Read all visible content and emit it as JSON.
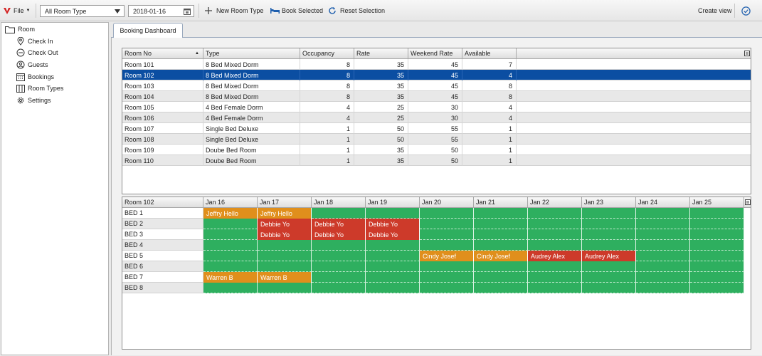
{
  "toolbar": {
    "file_label": "File",
    "room_type_value": "All Room Type",
    "date_value": "2018-01-16",
    "new_room_type": "New Room Type",
    "book_selected": "Book Selected",
    "reset_selection": "Reset Selection",
    "create_view": "Create view"
  },
  "sidebar": {
    "root": "Room",
    "items": [
      {
        "label": "Check In",
        "icon": "location-pin-icon"
      },
      {
        "label": "Check Out",
        "icon": "minus-circle-icon"
      },
      {
        "label": "Guests",
        "icon": "guests-icon"
      },
      {
        "label": "Bookings",
        "icon": "calendar-icon"
      },
      {
        "label": "Room Types",
        "icon": "room-types-icon"
      },
      {
        "label": "Settings",
        "icon": "gear-icon"
      }
    ]
  },
  "tab": {
    "label": "Booking Dashboard"
  },
  "rooms": {
    "columns": [
      "Room No",
      "Type",
      "Occupancy",
      "Rate",
      "Weekend Rate",
      "Available"
    ],
    "selected_index": 1,
    "rows": [
      [
        "Room 101",
        "8 Bed Mixed Dorm",
        "8",
        "35",
        "45",
        "7"
      ],
      [
        "Room 102",
        "8 Bed Mixed Dorm",
        "8",
        "35",
        "45",
        "4"
      ],
      [
        "Room 103",
        "8 Bed Mixed Dorm",
        "8",
        "35",
        "45",
        "8"
      ],
      [
        "Room 104",
        "8 Bed Mixed Dorm",
        "8",
        "35",
        "45",
        "8"
      ],
      [
        "Room 105",
        "4 Bed Female Dorm",
        "4",
        "25",
        "30",
        "4"
      ],
      [
        "Room 106",
        "4 Bed Female Dorm",
        "4",
        "25",
        "30",
        "4"
      ],
      [
        "Room 107",
        "Single Bed Deluxe",
        "1",
        "50",
        "55",
        "1"
      ],
      [
        "Room 108",
        "Single Bed Deluxe",
        "1",
        "50",
        "55",
        "1"
      ],
      [
        "Room 109",
        "Doube Bed Room",
        "1",
        "35",
        "50",
        "1"
      ],
      [
        "Room 110",
        "Doube Bed Room",
        "1",
        "35",
        "50",
        "1"
      ]
    ]
  },
  "schedule": {
    "room": "Room 102",
    "days": [
      "Jan 16",
      "Jan 17",
      "Jan 18",
      "Jan 19",
      "Jan 20",
      "Jan 21",
      "Jan 22",
      "Jan 23",
      "Jan 24",
      "Jan 25"
    ],
    "beds": [
      "BED 1",
      "BED 2",
      "BED 3",
      "BED 4",
      "BED 5",
      "BED 6",
      "BED 7",
      "BED 8"
    ],
    "bookings": [
      {
        "bed": 0,
        "day": 0,
        "guest": "Jeffry Hello",
        "status": "orange"
      },
      {
        "bed": 0,
        "day": 1,
        "guest": "Jeffry Hello",
        "status": "orange"
      },
      {
        "bed": 1,
        "day": 1,
        "guest": "Debbie Yo",
        "status": "red"
      },
      {
        "bed": 1,
        "day": 2,
        "guest": "Debbie Yo",
        "status": "red"
      },
      {
        "bed": 1,
        "day": 3,
        "guest": "Debbie Yo",
        "status": "red"
      },
      {
        "bed": 2,
        "day": 1,
        "guest": "Debbie Yo",
        "status": "red"
      },
      {
        "bed": 2,
        "day": 2,
        "guest": "Debbie Yo",
        "status": "red"
      },
      {
        "bed": 2,
        "day": 3,
        "guest": "Debbie Yo",
        "status": "red"
      },
      {
        "bed": 4,
        "day": 4,
        "guest": "Cindy Josef",
        "status": "orange"
      },
      {
        "bed": 4,
        "day": 5,
        "guest": "Cindy Josef",
        "status": "orange"
      },
      {
        "bed": 4,
        "day": 6,
        "guest": "Audrey Alex",
        "status": "red"
      },
      {
        "bed": 4,
        "day": 7,
        "guest": "Audrey Alex",
        "status": "red"
      },
      {
        "bed": 6,
        "day": 0,
        "guest": "Warren B",
        "status": "orange"
      },
      {
        "bed": 6,
        "day": 1,
        "guest": "Warren B",
        "status": "orange"
      }
    ]
  },
  "colors": {
    "available": "#2eaf5f",
    "orange": "#e08f1c",
    "red": "#cd3a2a",
    "selection": "#0b4ea2",
    "accent": "#1f5fae"
  }
}
